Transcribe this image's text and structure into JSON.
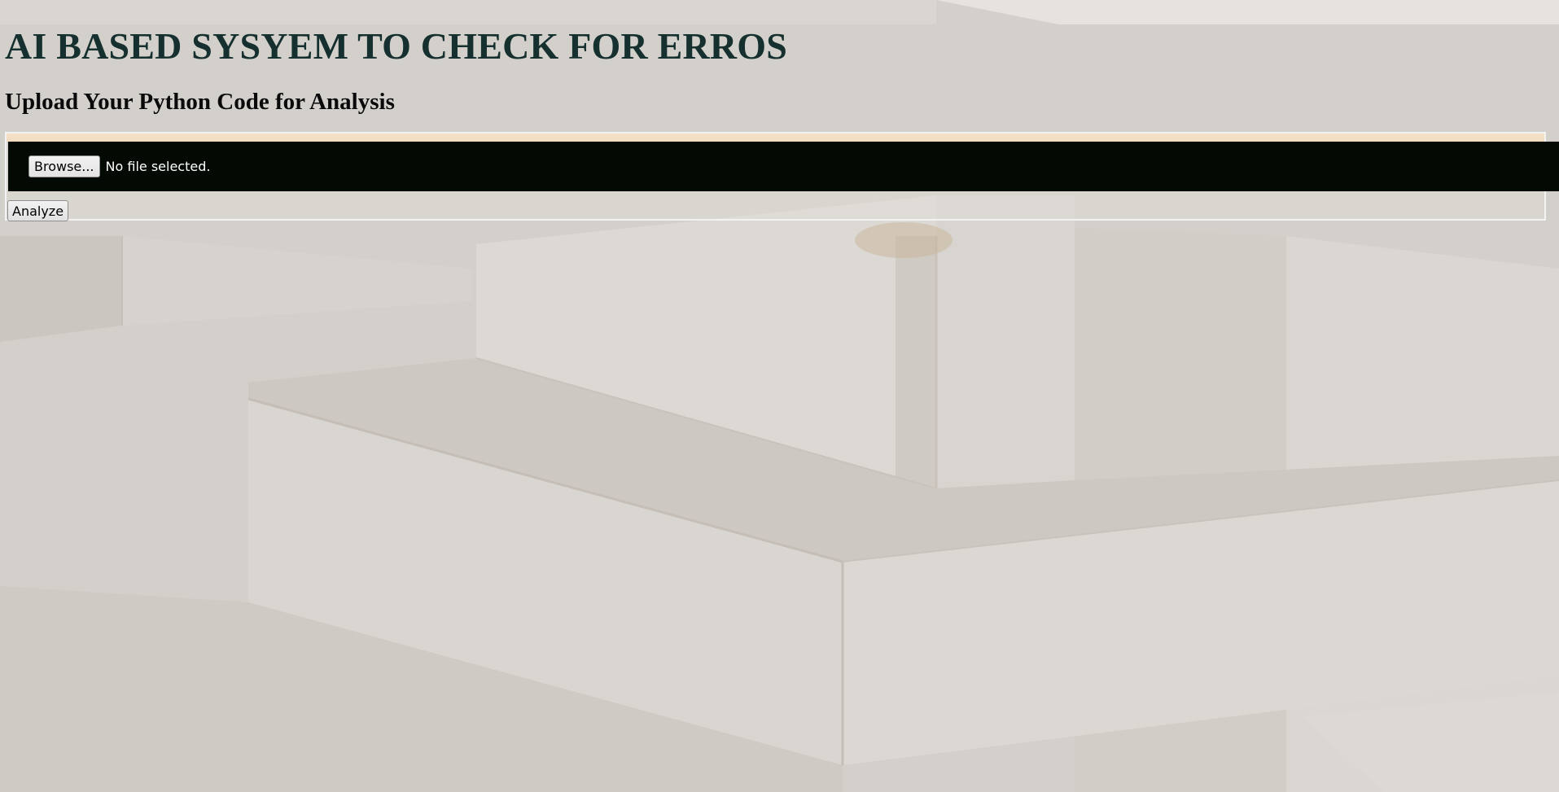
{
  "header": {
    "title": "AI BASED SYSYEM TO CHECK FOR ERROS",
    "subtitle": "Upload Your Python Code for Analysis"
  },
  "form": {
    "browse_label": "Browse...",
    "file_status": "No file selected.",
    "analyze_label": "Analyze"
  },
  "colors": {
    "title": "#15302f",
    "file_row_background": "#030a04",
    "page_background": "#d5d1cc"
  }
}
